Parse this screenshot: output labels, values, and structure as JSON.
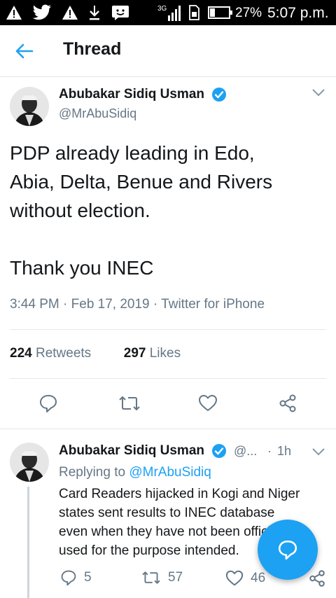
{
  "status_bar": {
    "network": "3G",
    "battery": "27%",
    "time": "5:07 p.m."
  },
  "header": {
    "title": "Thread"
  },
  "main_tweet": {
    "author_name": "Abubakar Sidiq Usman",
    "handle": "@MrAbuSidiq",
    "text_line1": "PDP already leading in Edo,",
    "text_line2": "Abia, Delta, Benue and Rivers",
    "text_line3": "without election.",
    "text_line4": "Thank you INEC",
    "meta": "3:44 PM · Feb 17, 2019 · Twitter for iPhone",
    "retweets_count": "224",
    "retweets_label": "Retweets",
    "likes_count": "297",
    "likes_label": "Likes"
  },
  "reply_tweet": {
    "author_name": "Abubakar Sidiq Usman",
    "handle_short": "@...",
    "time_sep": "·",
    "time": "1h",
    "replying_to_label": "Replying to",
    "replying_to_handle": "@MrAbuSidiq",
    "text_line1": "Card Readers hijacked in Kogi and Niger",
    "text_line2": "states sent results to INEC database",
    "text_line3": "even when they have not been officially",
    "text_line4": "used for the purpose intended.",
    "reply_count": "5",
    "retweet_count": "57",
    "like_count": "46"
  },
  "colors": {
    "accent": "#1da1f2",
    "text_primary": "#14171a",
    "text_secondary": "#657786",
    "divider": "#e1e8ed"
  }
}
